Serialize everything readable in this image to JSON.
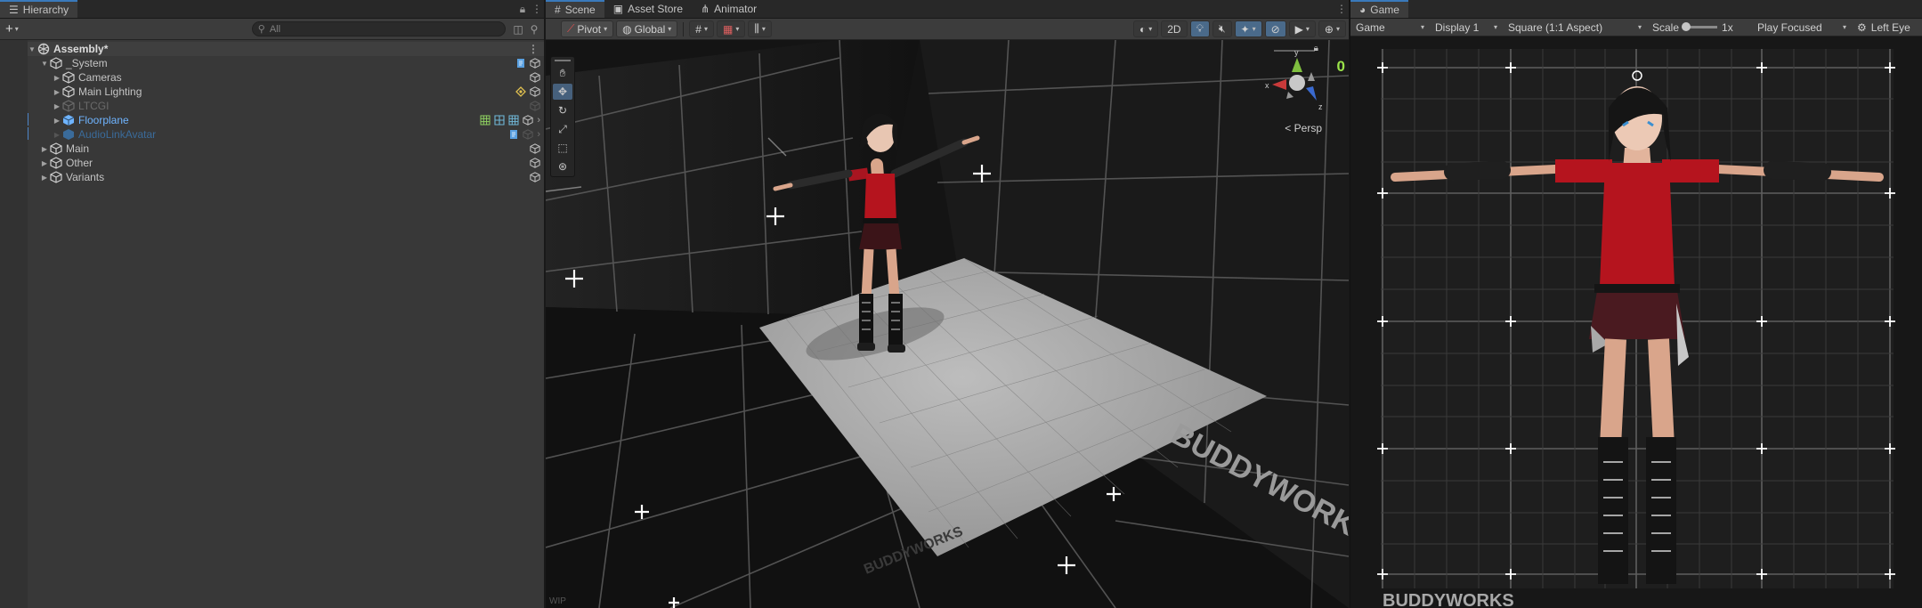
{
  "hierarchy": {
    "tab": "Hierarchy",
    "search_placeholder": "All",
    "add_label": "+",
    "scene_name": "Assembly*",
    "rows": [
      {
        "label": "_System",
        "style": "normal"
      },
      {
        "label": "Cameras",
        "style": "normal"
      },
      {
        "label": "Main Lighting",
        "style": "normal"
      },
      {
        "label": "LTCGI",
        "style": "disabled"
      },
      {
        "label": "Floorplane",
        "style": "prefab"
      },
      {
        "label": "AudioLinkAvatar",
        "style": "prefab-faded"
      },
      {
        "label": "Main",
        "style": "normal"
      },
      {
        "label": "Other",
        "style": "normal"
      },
      {
        "label": "Variants",
        "style": "normal"
      }
    ]
  },
  "scene": {
    "tabs": [
      {
        "label": "Scene",
        "icon": "grid-icon"
      },
      {
        "label": "Asset Store",
        "icon": "bag-icon"
      },
      {
        "label": "Animator",
        "icon": "animator-icon"
      }
    ],
    "pivot_label": "Pivot",
    "global_label": "Global",
    "toggle_2d": "2D",
    "persp_label": "Persp",
    "counter": "0",
    "axis_labels": {
      "x": "x",
      "y": "y",
      "z": "z"
    },
    "floor_text": "BUDDYWORKS",
    "wall_text": "BUDDYWORKS",
    "corner_text": "WIP"
  },
  "game": {
    "tab": "Game",
    "mode": "Game",
    "display": "Display 1",
    "aspect": "Square (1:1 Aspect)",
    "scale_label": "Scale",
    "scale_value": "1x",
    "play_mode": "Play Focused",
    "eye_label": "Left Eye",
    "watermark": "BUDDYWORKS"
  },
  "colors": {
    "accent": "#3a79bb",
    "prefab_blue": "#6fb4ff",
    "counter_green": "#9be34a",
    "outfit_red": "#b5141e"
  }
}
